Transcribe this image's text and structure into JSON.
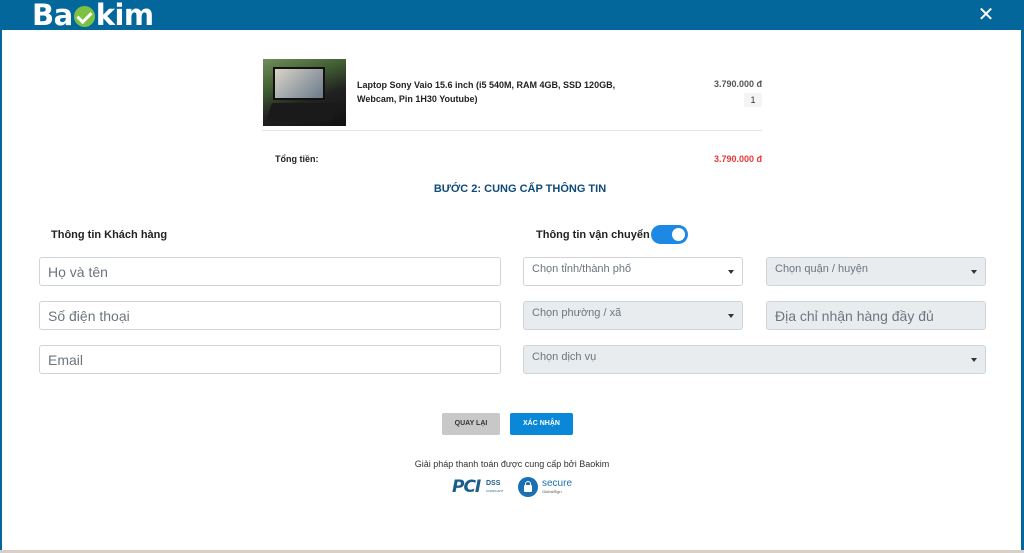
{
  "header": {
    "logo_start": "Ba",
    "logo_end": "kim",
    "close_glyph": "✕",
    "close_icon": "close-icon",
    "background_color": "#04679b"
  },
  "cart": {
    "product_name": "Laptop Sony Vaio 15.6 inch (i5 540M, RAM 4GB, SSD 120GB, Webcam, Pin 1H30 Youtube)",
    "product_price": "3.790.000 đ",
    "product_qty": "1",
    "total_label": "Tổng tiền:",
    "total_value": "3.790.000 đ"
  },
  "step_title": "BƯỚC 2: CUNG CẤP THÔNG TIN",
  "customer": {
    "section_title": "Thông tin Khách hàng",
    "name_placeholder": "Họ và tên",
    "phone_placeholder": "Số điện thoại",
    "email_placeholder": "Email"
  },
  "shipping": {
    "section_title": "Thông tin vận chuyển",
    "toggle_on": true,
    "province": "Chọn tỉnh/thành phố",
    "district": "Chọn quận / huyện",
    "ward": "Chọn phường / xã",
    "address_placeholder": "Địa chỉ nhận hàng đầy đủ",
    "service": "Chọn dịch vụ"
  },
  "buttons": {
    "back": "QUAY LẠI",
    "confirm": "XÁC NHẬN"
  },
  "footer": {
    "provided_by": "Giải pháp thanh toán được cung cấp bởi Baokim",
    "pci_text": "PCI",
    "pci_dss": "DSS",
    "pci_compliant": "COMPLIANT",
    "secure_text": "secure",
    "secure_sub": "GlobalSign"
  },
  "colors": {
    "accent": "#0a87d6",
    "price_red": "#e53935",
    "step_title": "#0e4a7a"
  }
}
